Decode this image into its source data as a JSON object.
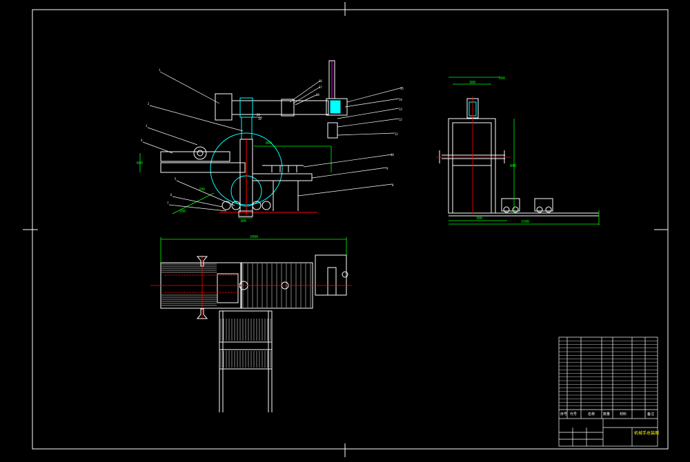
{
  "drawing": {
    "background": "#000000",
    "line_color": "#ffffff",
    "dim_color": "#00ff00",
    "leader_color": "#ffffff",
    "cyan": "#00ffff",
    "magenta": "#ff00ff",
    "red": "#ff0000",
    "yellow": "#ffff00",
    "blue": "#0000ff"
  },
  "front_view": {
    "balloons": [
      "1",
      "2",
      "3",
      "4",
      "5",
      "6",
      "7",
      "8",
      "9",
      "10",
      "11",
      "12",
      "13",
      "14",
      "15",
      "16",
      "17",
      "18",
      "19",
      "20"
    ],
    "dims": [
      "800",
      "600",
      "300",
      "200",
      "200"
    ]
  },
  "side_view": {
    "dims": [
      "500",
      "300",
      "800",
      "300",
      "1500"
    ]
  },
  "top_view": {
    "dims": [
      "2000"
    ]
  },
  "title_block": {
    "title": "机械手总装图",
    "rows": 20,
    "footer_labels": [
      "序号",
      "代号",
      "名称",
      "数量",
      "材料",
      "备注"
    ]
  }
}
